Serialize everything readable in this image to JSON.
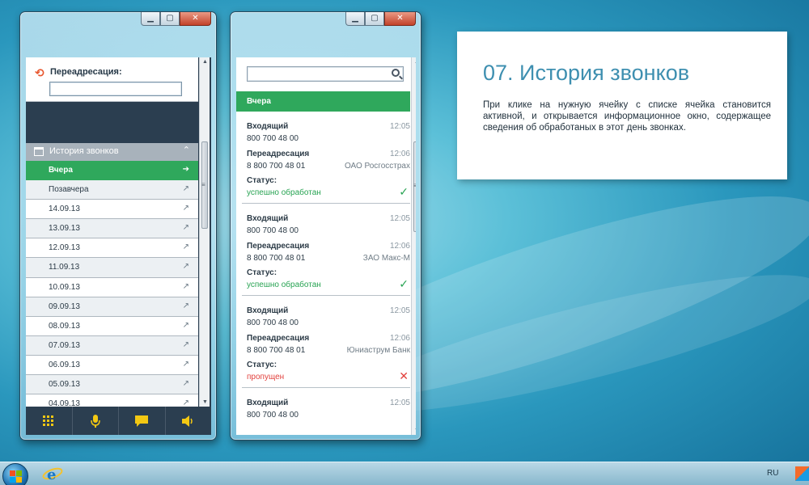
{
  "left_window": {
    "forwarding": {
      "label": "Переадресация:",
      "input_value": ""
    },
    "history": {
      "title": "История звонков",
      "dates": [
        "Вчера",
        "Позавчера",
        "14.09.13",
        "13.09.13",
        "12.09.13",
        "11.09.13",
        "10.09.13",
        "09.09.13",
        "08.09.13",
        "07.09.13",
        "06.09.13",
        "05.09.13",
        "04.09.13"
      ]
    },
    "toolbar": [
      "dialpad-icon",
      "microphone-icon",
      "chat-icon",
      "speaker-icon"
    ]
  },
  "mid_window": {
    "search_value": "",
    "day_header": "Вчера",
    "calls": [
      {
        "type": "Входящий",
        "number": "800 700 48 00",
        "time": "12:05",
        "forward_label": "Переадресация",
        "forward_time": "12:06",
        "forward_number": "8 800 700 48 01",
        "org": "ОАО Росгосстрах",
        "status_label": "Статус:",
        "status": "успешно обработан",
        "ok": true
      },
      {
        "type": "Входящий",
        "number": "800 700 48 00",
        "time": "12:05",
        "forward_label": "Переадресация",
        "forward_time": "12:06",
        "forward_number": "8 800 700 48 01",
        "org": "ЗАО Макс-М",
        "status_label": "Статус:",
        "status": "успешно обработан",
        "ok": true
      },
      {
        "type": "Входящий",
        "number": "800 700 48 00",
        "time": "12:05",
        "forward_label": "Переадресация",
        "forward_time": "12:06",
        "forward_number": "8 800 700 48 01",
        "org": "Юниаструм Банк",
        "status_label": "Статус:",
        "status": "пропущен",
        "ok": false
      },
      {
        "type": "Входящий",
        "number": "800 700 48 00",
        "time": "12:05"
      }
    ]
  },
  "info": {
    "title": "07. История звонков",
    "text": "При клике на нужную ячейку с списке ячейка становится активной, и открывается информационное  окно, содержащее сведения об обработаных в этот день звонках."
  },
  "taskbar": {
    "lang": "RU"
  },
  "colors": {
    "accent_green": "#2fa85c",
    "panel_dark": "#2b3e50",
    "title_blue": "#3e8fb0",
    "missed_red": "#e2413d",
    "icon_yellow": "#f3c813"
  }
}
